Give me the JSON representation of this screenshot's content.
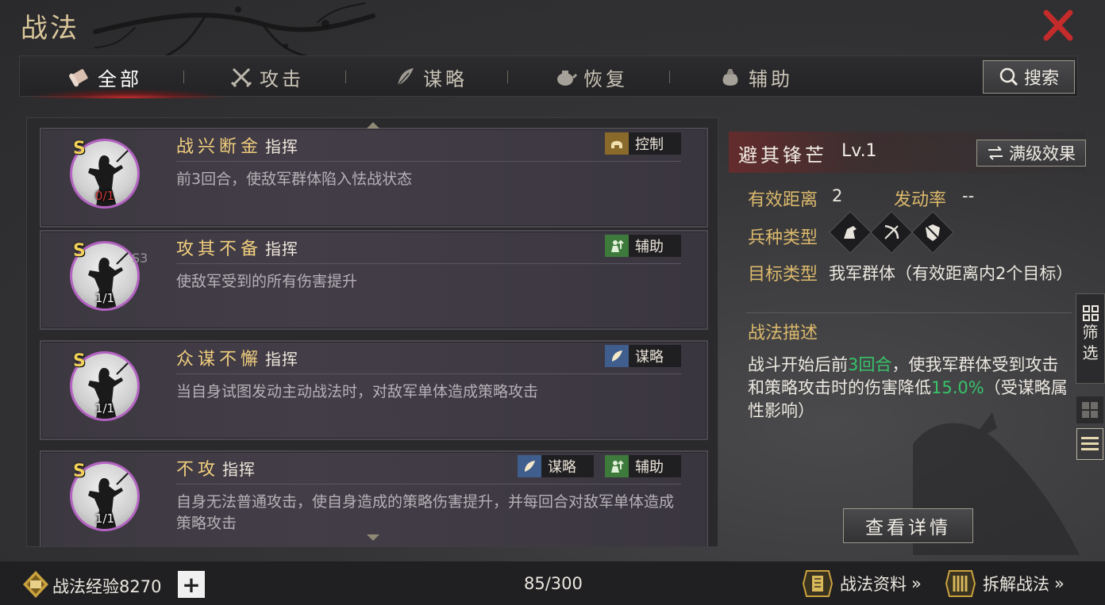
{
  "header": {
    "title": "战法"
  },
  "tabs": [
    {
      "label": "全部",
      "icon": "scroll-icon",
      "active": true
    },
    {
      "label": "攻击",
      "icon": "crossed-swords-icon",
      "active": false
    },
    {
      "label": "谋略",
      "icon": "feather-icon",
      "active": false
    },
    {
      "label": "恢复",
      "icon": "teapot-icon",
      "active": false
    },
    {
      "label": "辅助",
      "icon": "pouch-icon",
      "active": false
    }
  ],
  "search": {
    "label": "搜索",
    "icon": "search-icon"
  },
  "list": {
    "cards": [
      {
        "grade": "S",
        "sub": "",
        "count": "0/1",
        "count_color": "#d23a3a",
        "name": "战兴断金",
        "kind": "指挥",
        "desc": "前3回合，使敌军群体陷入怯战状态",
        "tags": [
          {
            "label": "控制",
            "icon": "helmet-icon",
            "color": "#8a6a2a"
          }
        ]
      },
      {
        "grade": "S",
        "sub": "S3",
        "count": "1/1",
        "count_color": "#f2f2f2",
        "name": "攻其不备",
        "kind": "指挥",
        "desc": "使敌军受到的所有伤害提升",
        "tags": [
          {
            "label": "辅助",
            "icon": "buff-icon",
            "color": "#3e7a3c"
          }
        ]
      },
      {
        "grade": "S",
        "sub": "",
        "count": "1/1",
        "count_color": "#f2f2f2",
        "name": "众谋不懈",
        "kind": "指挥",
        "desc": "当自身试图发动主动战法时，对敌军单体造成策略攻击",
        "tags": [
          {
            "label": "谋略",
            "icon": "strategy-icon",
            "color": "#3f5e8e"
          }
        ]
      },
      {
        "grade": "S",
        "sub": "",
        "count": "1/1",
        "count_color": "#f2f2f2",
        "name": "不攻",
        "kind": "指挥",
        "desc": "自身无法普通攻击，使自身造成的策略伤害提升，并每回合对敌军单体造成策略攻击",
        "tags": [
          {
            "label": "谋略",
            "icon": "strategy-icon",
            "color": "#3f5e8e"
          },
          {
            "label": "辅助",
            "icon": "buff-icon",
            "color": "#3e7a3c"
          }
        ]
      }
    ]
  },
  "detail": {
    "name": "避其锋芒",
    "level": "Lv.1",
    "max_level_button": "满级效果",
    "range_label": "有效距离",
    "range_value": "2",
    "rate_label": "发动率",
    "rate_value": "--",
    "troop_label": "兵种类型",
    "troops": [
      "cavalry-icon",
      "archer-icon",
      "shield-icon"
    ],
    "target_label": "目标类型",
    "target_value": "我军群体（有效距离内2个目标）",
    "desc_title": "战法描述",
    "desc_parts": [
      "战斗开始后前",
      "3回合",
      "，使我军群体受到攻击和策略攻击时的伤害降低",
      "15.0%",
      "（受谋略属性影响）"
    ],
    "detail_button": "查看详情"
  },
  "side": {
    "filter_label_1": "筛",
    "filter_label_2": "选"
  },
  "bottom": {
    "exp_label": "战法经验",
    "exp_value": "8270",
    "capacity": "85/300",
    "link_info": "战法资料",
    "link_dismantle": "拆解战法",
    "chevron": "»"
  },
  "colors": {
    "accent_gold": "#dcb96c",
    "highlight_green": "#38c36a",
    "close_red": "#c42b2b",
    "portrait_ring": "#b463c2"
  }
}
